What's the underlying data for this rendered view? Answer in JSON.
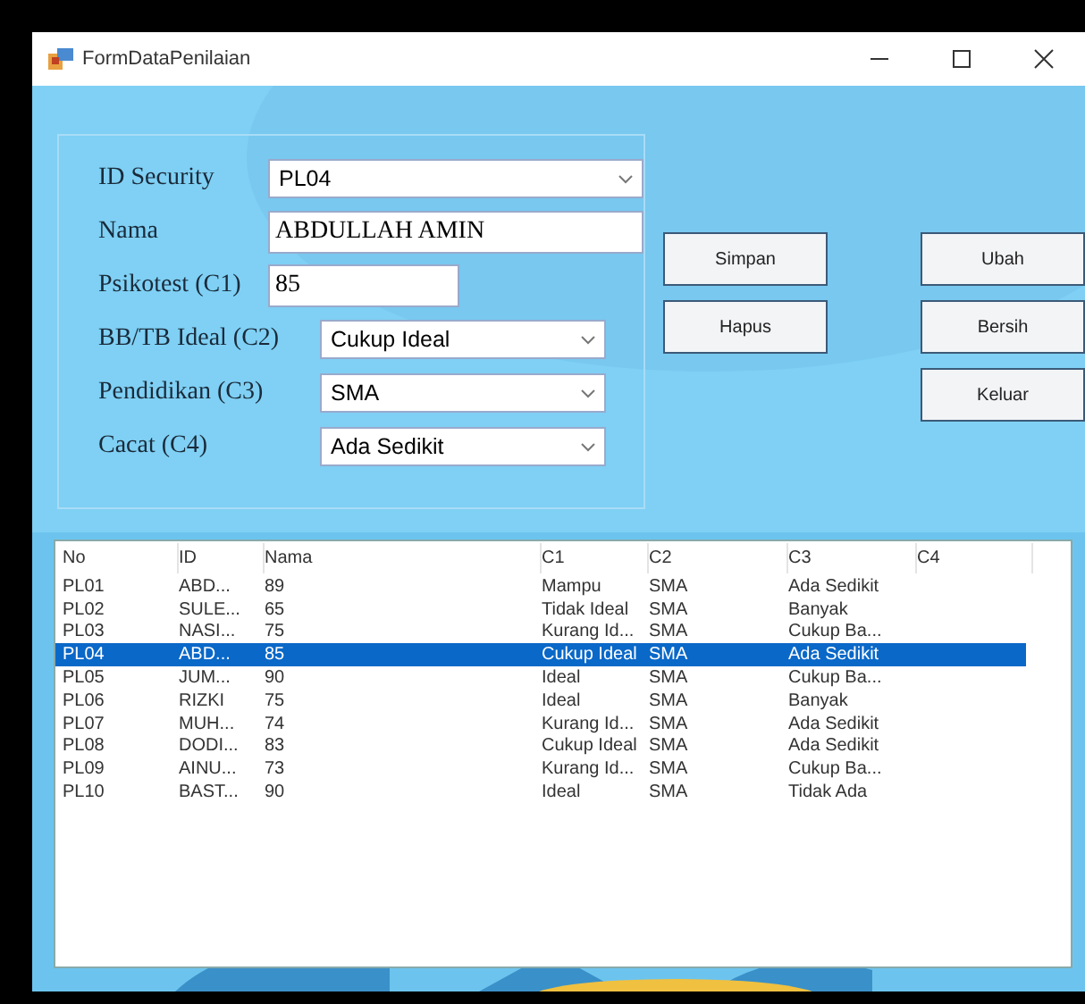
{
  "window": {
    "title": "FormDataPenilaian"
  },
  "form": {
    "fields": [
      {
        "kind": "combo",
        "label": "ID Security",
        "value": "PL04"
      },
      {
        "kind": "text",
        "label": "Nama",
        "value": "ABDULLAH AMIN"
      },
      {
        "kind": "text",
        "label": "Psikotest (C1)",
        "value": "85"
      },
      {
        "kind": "combo",
        "label": "BB/TB Ideal (C2)",
        "value": "Cukup Ideal"
      },
      {
        "kind": "combo",
        "label": "Pendidikan (C3)",
        "value": "SMA"
      },
      {
        "kind": "combo",
        "label": "Cacat (C4)",
        "value": "Ada Sedikit"
      }
    ]
  },
  "buttons": [
    [
      "Simpan",
      "Ubah"
    ],
    [
      "Hapus",
      "Bersih"
    ],
    [
      "Keluar"
    ]
  ],
  "table": {
    "columns": [
      "No",
      "ID",
      "Nama",
      "C1",
      "C2",
      "C3",
      "C4"
    ],
    "rows": [
      {
        "cells": [
          "PL01",
          "ABD...",
          "89",
          "Mampu",
          "SMA",
          "Ada Sedikit"
        ],
        "selected": false
      },
      {
        "cells": [
          "PL02",
          "SULE...",
          "65",
          "Tidak Ideal",
          "SMA",
          "Banyak"
        ],
        "selected": false
      },
      {
        "cells": [
          "PL03",
          "NASI...",
          "75",
          "Kurang Id...",
          "SMA",
          "Cukup Ba..."
        ],
        "selected": false
      },
      {
        "cells": [
          "PL04",
          "ABD...",
          "85",
          "Cukup Ideal",
          "SMA",
          "Ada Sedikit"
        ],
        "selected": true
      },
      {
        "cells": [
          "PL05",
          "JUM...",
          "90",
          "Ideal",
          "SMA",
          "Cukup Ba..."
        ],
        "selected": false
      },
      {
        "cells": [
          "PL06",
          "RIZKI",
          "75",
          "Ideal",
          "SMA",
          "Banyak"
        ],
        "selected": false
      },
      {
        "cells": [
          "PL07",
          "MUH...",
          "74",
          "Kurang Id...",
          "SMA",
          "Ada Sedikit"
        ],
        "selected": false
      },
      {
        "cells": [
          "PL08",
          "DODI...",
          "83",
          "Cukup Ideal",
          "SMA",
          "Ada Sedikit"
        ],
        "selected": false
      },
      {
        "cells": [
          "PL09",
          "AINU...",
          "73",
          "Kurang Id...",
          "SMA",
          "Cukup Ba..."
        ],
        "selected": false
      },
      {
        "cells": [
          "PL10",
          "BAST...",
          "90",
          "Ideal",
          "SMA",
          "Tidak Ada"
        ],
        "selected": false
      }
    ]
  }
}
